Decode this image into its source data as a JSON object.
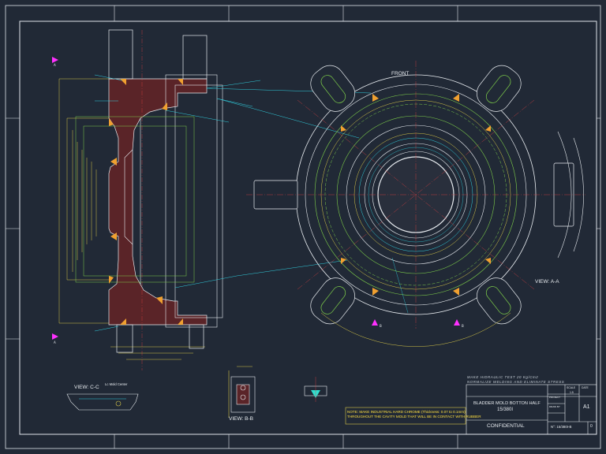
{
  "drawing": {
    "front_label": "FRONT",
    "view_aa": "VIEW: A-A",
    "view_bb": "VIEW: B-B",
    "view_cc": "VIEW: C-C",
    "mold_center": "Lc Mold Center",
    "section_a": "A",
    "section_b": "B",
    "hydraulic_test": "MAKE HIDRAULIC TEST   20 Kg/Cm2",
    "normalize": "NORMALIZE WELDING AND ELIMINATE STRESS",
    "note_line1": "NOTE: MAKE INDUSTRIAL HARD CHROME (Thickness: 0.07 to 0.1mm)",
    "note_line2": "THROUGHOUT THE CAVITY MOLD THAT WILL BE IN CONTACT WITH RUBBER"
  },
  "title_block": {
    "title_line1": "BLADDER MOLD BOTTON HALF",
    "title_line2": "15/380I",
    "confidential": "CONFIDENTIAL",
    "scale_label": "SCALE",
    "scale_value": "1:5",
    "date_label": "DATE",
    "size": "A1",
    "drawing_no": "N°: 15/380I-B",
    "sheet": "0",
    "project": "PROJECT",
    "drawn_by": "DRAW BY"
  },
  "colors": {
    "background": "#212936",
    "line": "#e8ecf0",
    "cyan": "#30d0e0",
    "green": "#7ecf4a",
    "yellow": "#ffe040",
    "orange": "#f0a030",
    "red": "#e04040",
    "magenta": "#ff30ff"
  }
}
